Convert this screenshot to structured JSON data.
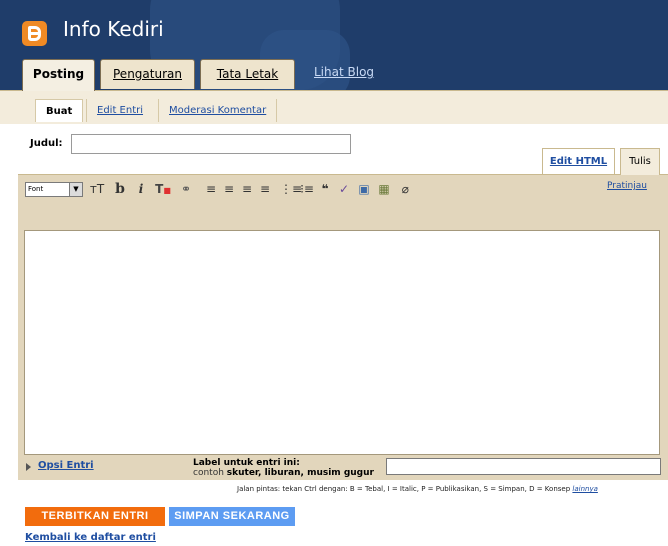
{
  "app": {
    "blog_title": "Info Kediri"
  },
  "tabs": {
    "posting": "Posting",
    "pengaturan": "Pengaturan",
    "tata_letak": "Tata Letak",
    "lihat_blog": "Lihat Blog"
  },
  "subnav": {
    "buat": "Buat",
    "edit_entri": "Edit Entri",
    "moderasi": "Moderasi Komentar"
  },
  "post": {
    "title_label": "Judul:",
    "title_value": ""
  },
  "editor": {
    "mode_html": "Edit HTML",
    "mode_compose": "Tulis",
    "font_select": "Font",
    "preview": "Pratinjau",
    "toolbar_icons": [
      "font-size-icon",
      "bold-icon",
      "italic-icon",
      "text-color-icon",
      "link-icon",
      "align-left-icon",
      "align-center-icon",
      "align-right-icon",
      "justify-icon",
      "numbered-list-icon",
      "bulleted-list-icon",
      "blockquote-icon",
      "spellcheck-icon",
      "image-icon",
      "video-icon",
      "remove-formatting-icon"
    ]
  },
  "options": {
    "opsi_entri": "Opsi Entri",
    "label_title": "Label untuk entri ini:",
    "label_example_prefix": "contoh ",
    "label_example_values": "skuter, liburan, musim gugur"
  },
  "shortcuts": {
    "text": "Jalan pintas: tekan Ctrl dengan: B = Tebal, I = Italic, P = Publikasikan, S = Simpan, D = Konsep",
    "more": "lainnya"
  },
  "buttons": {
    "publish": "TERBITKAN ENTRI",
    "save": "SIMPAN SEKARANG",
    "back": "Kembali ke daftar entri"
  },
  "colors": {
    "header_bg": "#1f3d6a",
    "publish": "#f26c0d",
    "save": "#5d9cf2",
    "link": "#1f4ea1",
    "logo": "#f08a24"
  }
}
